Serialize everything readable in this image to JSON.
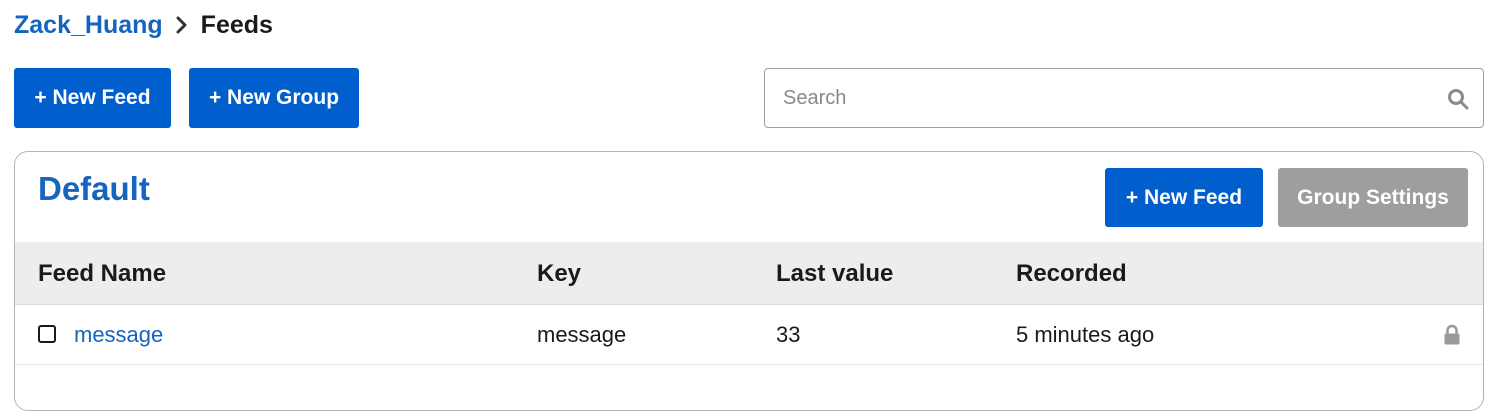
{
  "breadcrumb": {
    "user": "Zack_Huang",
    "separator_icon": "chevron-right-icon",
    "current": "Feeds"
  },
  "toolbar": {
    "new_feed_label": "+ New Feed",
    "new_group_label": "+ New Group"
  },
  "search": {
    "placeholder": "Search",
    "value": "",
    "icon": "search-icon"
  },
  "group": {
    "title": "Default",
    "new_feed_label": "+ New Feed",
    "settings_label": "Group Settings",
    "table": {
      "columns": [
        "Feed Name",
        "Key",
        "Last value",
        "Recorded"
      ],
      "rows": [
        {
          "name": "message",
          "key": "message",
          "last_value": "33",
          "recorded": "5 minutes ago",
          "checked": false,
          "private_icon": "lock-icon"
        }
      ]
    }
  },
  "colors": {
    "primary_button": "#005fcc",
    "link": "#1565c0",
    "disabled_button": "#9e9e9e",
    "table_header_bg": "#ededed"
  }
}
